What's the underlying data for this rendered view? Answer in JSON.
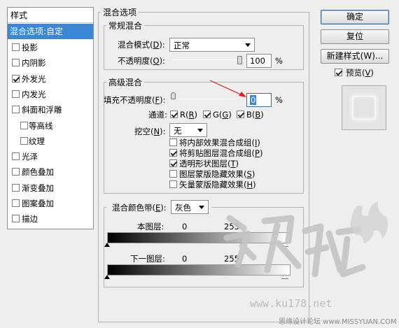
{
  "styles_panel": {
    "header": "样式",
    "selected": "混合选项:自定",
    "items": [
      {
        "label": "投影",
        "checked": false,
        "indent": false
      },
      {
        "label": "内阴影",
        "checked": false,
        "indent": false
      },
      {
        "label": "外发光",
        "checked": true,
        "indent": false
      },
      {
        "label": "内发光",
        "checked": false,
        "indent": false
      },
      {
        "label": "斜面和浮雕",
        "checked": false,
        "indent": false
      },
      {
        "label": "等高线",
        "checked": false,
        "indent": true
      },
      {
        "label": "纹理",
        "checked": false,
        "indent": true
      },
      {
        "label": "光泽",
        "checked": false,
        "indent": false
      },
      {
        "label": "颜色叠加",
        "checked": false,
        "indent": false
      },
      {
        "label": "渐变叠加",
        "checked": false,
        "indent": false
      },
      {
        "label": "图案叠加",
        "checked": false,
        "indent": false
      },
      {
        "label": "描边",
        "checked": false,
        "indent": false
      }
    ]
  },
  "blending_options": {
    "title": "混合选项",
    "general": {
      "title": "常规混合",
      "blend_mode_label_pre": "混合模式(",
      "blend_mode_key": "D",
      "blend_mode_label_post": "):",
      "blend_mode_value": "正常",
      "opacity_label_pre": "不透明度(",
      "opacity_key": "O",
      "opacity_label_post": "):",
      "opacity_value": "100",
      "opacity_unit": "%",
      "opacity_level": 1.0
    },
    "advanced": {
      "title": "高级混合",
      "fill_opacity_label_pre": "填充不透明度(",
      "fill_opacity_key": "F",
      "fill_opacity_label_post": "):",
      "fill_opacity_value": "0",
      "fill_opacity_unit": "%",
      "fill_opacity_level": 0.0,
      "channels_label_pre": "通道:",
      "channels": [
        {
          "label": "R(",
          "key": "R",
          "post": ")",
          "checked": true
        },
        {
          "label": "G(",
          "key": "G",
          "post": ")",
          "checked": true
        },
        {
          "label": "B(",
          "key": "B",
          "post": ")",
          "checked": true
        }
      ],
      "knockout_label_pre": "挖空(",
      "knockout_key": "N",
      "knockout_label_post": "):",
      "knockout_value": "无",
      "options": [
        {
          "label": "将内部效果混合成组(",
          "key": "I",
          "post": ")",
          "checked": false
        },
        {
          "label": "将剪贴图层混合成组(",
          "key": "P",
          "post": ")",
          "checked": true
        },
        {
          "label": "透明形状图层(",
          "key": "T",
          "post": ")",
          "checked": true
        },
        {
          "label": "图层蒙版隐藏效果(",
          "key": "S",
          "post": ")",
          "checked": false
        },
        {
          "label": "矢量蒙版隐藏效果(",
          "key": "H",
          "post": ")",
          "checked": false
        }
      ]
    },
    "blend_if": {
      "label_pre": "混合颜色带(",
      "key": "E",
      "label_post": "):",
      "value": "灰色",
      "this_layer_label": "本图层:",
      "this_layer_min": "0",
      "this_layer_max": "255",
      "underlying_label": "下一图层:",
      "underlying_min": "0",
      "underlying_max": "255"
    }
  },
  "buttons": {
    "ok": "确定",
    "reset": "复位",
    "new_style": "新建样式(W)...",
    "preview_label": "预览(",
    "preview_key": "V",
    "preview_post": ")",
    "preview_checked": true
  },
  "watermark": {
    "url": "www.ku178.net",
    "footer": "思缘设计论坛 www.MISSYUAN.COM"
  },
  "colors": {
    "selection": "#3a87d6",
    "annotation_arrow": "#e02020"
  }
}
